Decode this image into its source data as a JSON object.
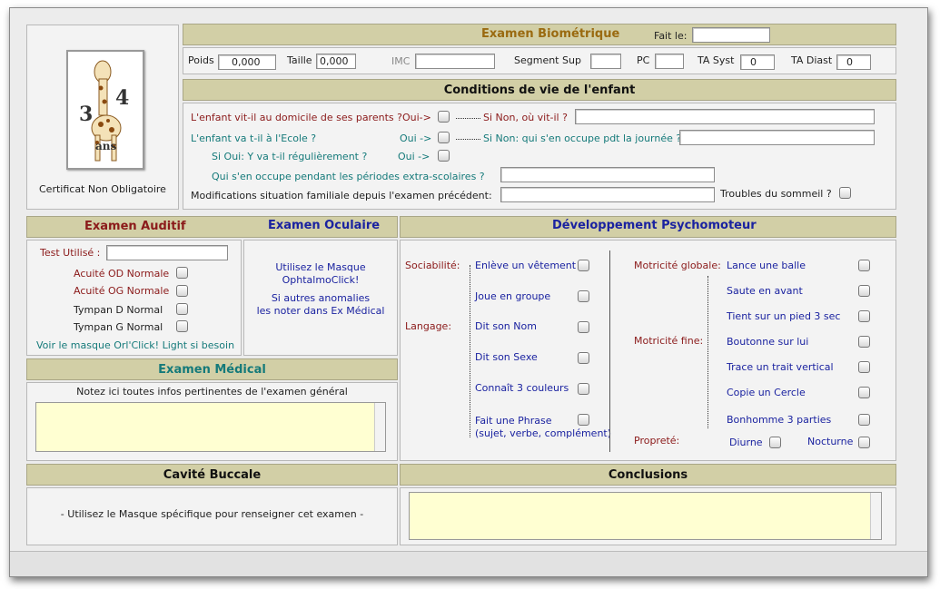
{
  "certificat": {
    "label": "Certificat Non Obligatoire",
    "logo_text": "3 4 ans"
  },
  "biometrie": {
    "title": "Examen Biométrique",
    "fait_le": "Fait le:",
    "fait_le_value": "",
    "poids_label": "Poids",
    "poids": "0,000",
    "taille_label": "Taille",
    "taille": "0,000",
    "imc_label": "IMC",
    "imc": "",
    "segment_label": "Segment Sup",
    "segment": "",
    "pc_label": "PC",
    "pc": "",
    "ta_syst_label": "TA Syst",
    "ta_syst": "0",
    "ta_diast_label": "TA Diast",
    "ta_diast": "0"
  },
  "conditions": {
    "title": "Conditions de vie de l'enfant",
    "q1": "L'enfant vit-il au domicile de ses parents ?",
    "q1_oui": "Oui->",
    "q1_non": "Si Non, où vit-il ?",
    "q2": "L'enfant va t-il à l'Ecole ?",
    "q2_oui": "Oui ->",
    "q2_non": "Si Non: qui s'en occupe pdt la journée ?",
    "q3": "Si Oui: Y va t-il régulièrement ?",
    "q3_oui": "Oui ->",
    "q4": "Qui s'en occupe pendant les périodes extra-scolaires ?",
    "q5": "Modifications situation familiale depuis l'examen précédent:",
    "sommeil": "Troubles du sommeil ?"
  },
  "auditif": {
    "title": "Examen Auditif",
    "test_label": "Test Utilisé :",
    "test_value": "",
    "items": [
      "Acuité OD Normale",
      "Acuité OG Normale",
      "Tympan D Normal",
      "Tympan G Normal"
    ],
    "link": "Voir le masque Orl'Click! Light si besoin"
  },
  "oculaire": {
    "title": "Examen Oculaire",
    "line1": "Utilisez le Masque",
    "line2": "OphtalmoClick!",
    "line3": "Si autres anomalies",
    "line4": "les noter dans Ex Médical"
  },
  "psycho": {
    "title": "Développement Psychomoteur",
    "sociabilite": "Sociabilité:",
    "langage": "Langage:",
    "soc_items": [
      "Enlève un vêtement",
      "Joue en groupe"
    ],
    "lang_items": [
      "Dit son Nom",
      "Dit son Sexe",
      "Connaît 3 couleurs",
      "Fait une Phrase"
    ],
    "phrase_sub": "(sujet, verbe, complément)",
    "motricite_globale": "Motricité globale:",
    "motricite_fine": "Motricité fine:",
    "proprete": "Propreté:",
    "glob_items": [
      "Lance une balle",
      "Saute en avant",
      "Tient sur un pied 3 sec"
    ],
    "fine_items": [
      "Boutonne sur lui",
      "Trace un trait vertical",
      "Copie un Cercle",
      "Bonhomme 3 parties"
    ],
    "diurne": "Diurne",
    "nocturne": "Nocturne"
  },
  "medical": {
    "title": "Examen Médical",
    "note": "Notez ici toutes infos pertinentes de l'examen général"
  },
  "buccale": {
    "title": "Cavité Buccale",
    "note": "- Utilisez le Masque spécifique pour renseigner cet examen -"
  },
  "conclusions": {
    "title": "Conclusions"
  },
  "colors": {
    "bar": "#d2cfa6",
    "title_gold": "#9a6a10",
    "red": "#8b1a1a",
    "teal": "#157a7a",
    "blue": "#1a22a0",
    "textarea": "#ffffd2"
  }
}
